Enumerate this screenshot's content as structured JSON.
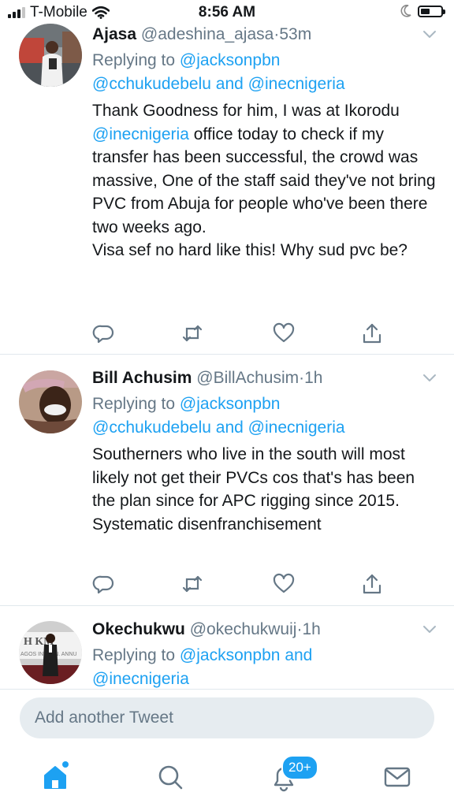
{
  "status_bar": {
    "carrier": "T-Mobile",
    "time": "8:56 AM"
  },
  "tweets": [
    {
      "name": "Ajasa",
      "handle": "@adeshina_ajasa",
      "separator": "·",
      "time": "53m",
      "replying_prefix": "Replying to",
      "mention_1": "@jacksonpbn",
      "mention_2": "@cchukudebelu",
      "connector": "and",
      "mention_3": "@inecnigeria",
      "body_a": "Thank Goodness for him, I was at Ikorodu",
      "body_mention": "@inecnigeria",
      "body_b": "office today to check if my transfer has been successful, the crowd was massive, One of the staff said they've not bring PVC from Abuja for people who've been there two weeks ago.",
      "body_c": "Visa sef no hard like this! Why sud pvc be?"
    },
    {
      "name": "Bill Achusim",
      "handle": "@BillAchusim",
      "separator": "·",
      "time": "1h",
      "replying_prefix": "Replying to",
      "mention_1": "@jacksonpbn",
      "mention_2": "@cchukudebelu",
      "connector": "and",
      "mention_3": "@inecnigeria",
      "body_a": "Southerners who live in the south will most likely not get their PVCs cos that's has been the plan since for APC rigging since 2015.",
      "body_b": "Systematic disenfranchisement"
    },
    {
      "name": "Okechukwu",
      "handle": "@okechukwuij",
      "separator": "·",
      "time": "1h",
      "replying_prefix": "Replying to",
      "mention_1": "@jacksonpbn",
      "connector": "and",
      "mention_2": "@inecnigeria"
    }
  ],
  "compose": {
    "placeholder": "Add another Tweet"
  },
  "tab_bar": {
    "notifications_badge": "20+"
  },
  "icons": {
    "signal": "signal-bars-icon",
    "wifi": "wifi-icon",
    "moon": "moon-icon",
    "battery": "battery-icon",
    "reply": "reply-icon",
    "retweet": "retweet-icon",
    "like": "heart-icon",
    "share": "share-icon",
    "caret": "chevron-down-icon",
    "home": "home-icon",
    "search": "search-icon",
    "notifications": "bell-icon",
    "messages": "mail-icon"
  },
  "colors": {
    "accent": "#1da1f2",
    "muted": "#657786",
    "text": "#14171a",
    "divider": "#e1e8ed",
    "compose_bg": "#e6ecf0"
  }
}
